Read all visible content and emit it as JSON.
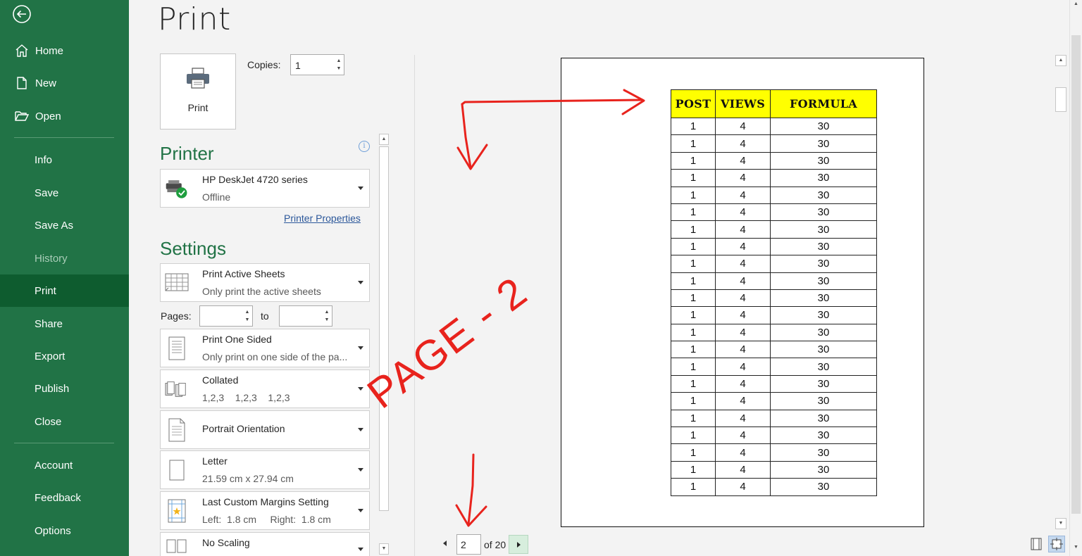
{
  "sidebar": {
    "items": [
      {
        "label": "Home"
      },
      {
        "label": "New"
      },
      {
        "label": "Open"
      },
      {
        "label": "Info"
      },
      {
        "label": "Save"
      },
      {
        "label": "Save As"
      },
      {
        "label": "History"
      },
      {
        "label": "Print"
      },
      {
        "label": "Share"
      },
      {
        "label": "Export"
      },
      {
        "label": "Publish"
      },
      {
        "label": "Close"
      },
      {
        "label": "Account"
      },
      {
        "label": "Feedback"
      },
      {
        "label": "Options"
      }
    ],
    "selected": "Print",
    "background": "#217346"
  },
  "page_title": "Print",
  "print_button": {
    "label": "Print"
  },
  "copies": {
    "label": "Copies:",
    "value": "1"
  },
  "printer": {
    "section_title": "Printer",
    "name": "HP DeskJet 4720 series",
    "status": "Offline",
    "properties_link": "Printer Properties"
  },
  "settings": {
    "section_title": "Settings",
    "what_to_print": {
      "title": "Print Active Sheets",
      "subtitle": "Only print the active sheets"
    },
    "pages": {
      "label": "Pages:",
      "from": "",
      "to_label": "to",
      "to": ""
    },
    "sides": {
      "title": "Print One Sided",
      "subtitle": "Only print on one side of the pa..."
    },
    "collation": {
      "title": "Collated",
      "subtitle": "1,2,3    1,2,3    1,2,3"
    },
    "orientation": {
      "title": "Portrait Orientation"
    },
    "paper": {
      "title": "Letter",
      "subtitle": "21.59 cm x 27.94 cm"
    },
    "margins": {
      "title": "Last Custom Margins Setting",
      "subtitle": "Left:  1.8 cm     Right:  1.8 cm"
    },
    "scaling": {
      "title": "No Scaling"
    }
  },
  "preview": {
    "headers": [
      "POST",
      "VIEWS",
      "FORMULA"
    ],
    "header_color": "#ffff00",
    "rows": [
      [
        "1",
        "4",
        "30"
      ],
      [
        "1",
        "4",
        "30"
      ],
      [
        "1",
        "4",
        "30"
      ],
      [
        "1",
        "4",
        "30"
      ],
      [
        "1",
        "4",
        "30"
      ],
      [
        "1",
        "4",
        "30"
      ],
      [
        "1",
        "4",
        "30"
      ],
      [
        "1",
        "4",
        "30"
      ],
      [
        "1",
        "4",
        "30"
      ],
      [
        "1",
        "4",
        "30"
      ],
      [
        "1",
        "4",
        "30"
      ],
      [
        "1",
        "4",
        "30"
      ],
      [
        "1",
        "4",
        "30"
      ],
      [
        "1",
        "4",
        "30"
      ],
      [
        "1",
        "4",
        "30"
      ],
      [
        "1",
        "4",
        "30"
      ],
      [
        "1",
        "4",
        "30"
      ],
      [
        "1",
        "4",
        "30"
      ],
      [
        "1",
        "4",
        "30"
      ],
      [
        "1",
        "4",
        "30"
      ],
      [
        "1",
        "4",
        "30"
      ],
      [
        "1",
        "4",
        "30"
      ]
    ]
  },
  "page_nav": {
    "current": "2",
    "of_label": "of 20"
  },
  "annotation": {
    "text": "PAGE - 2",
    "color": "#e8231d"
  }
}
